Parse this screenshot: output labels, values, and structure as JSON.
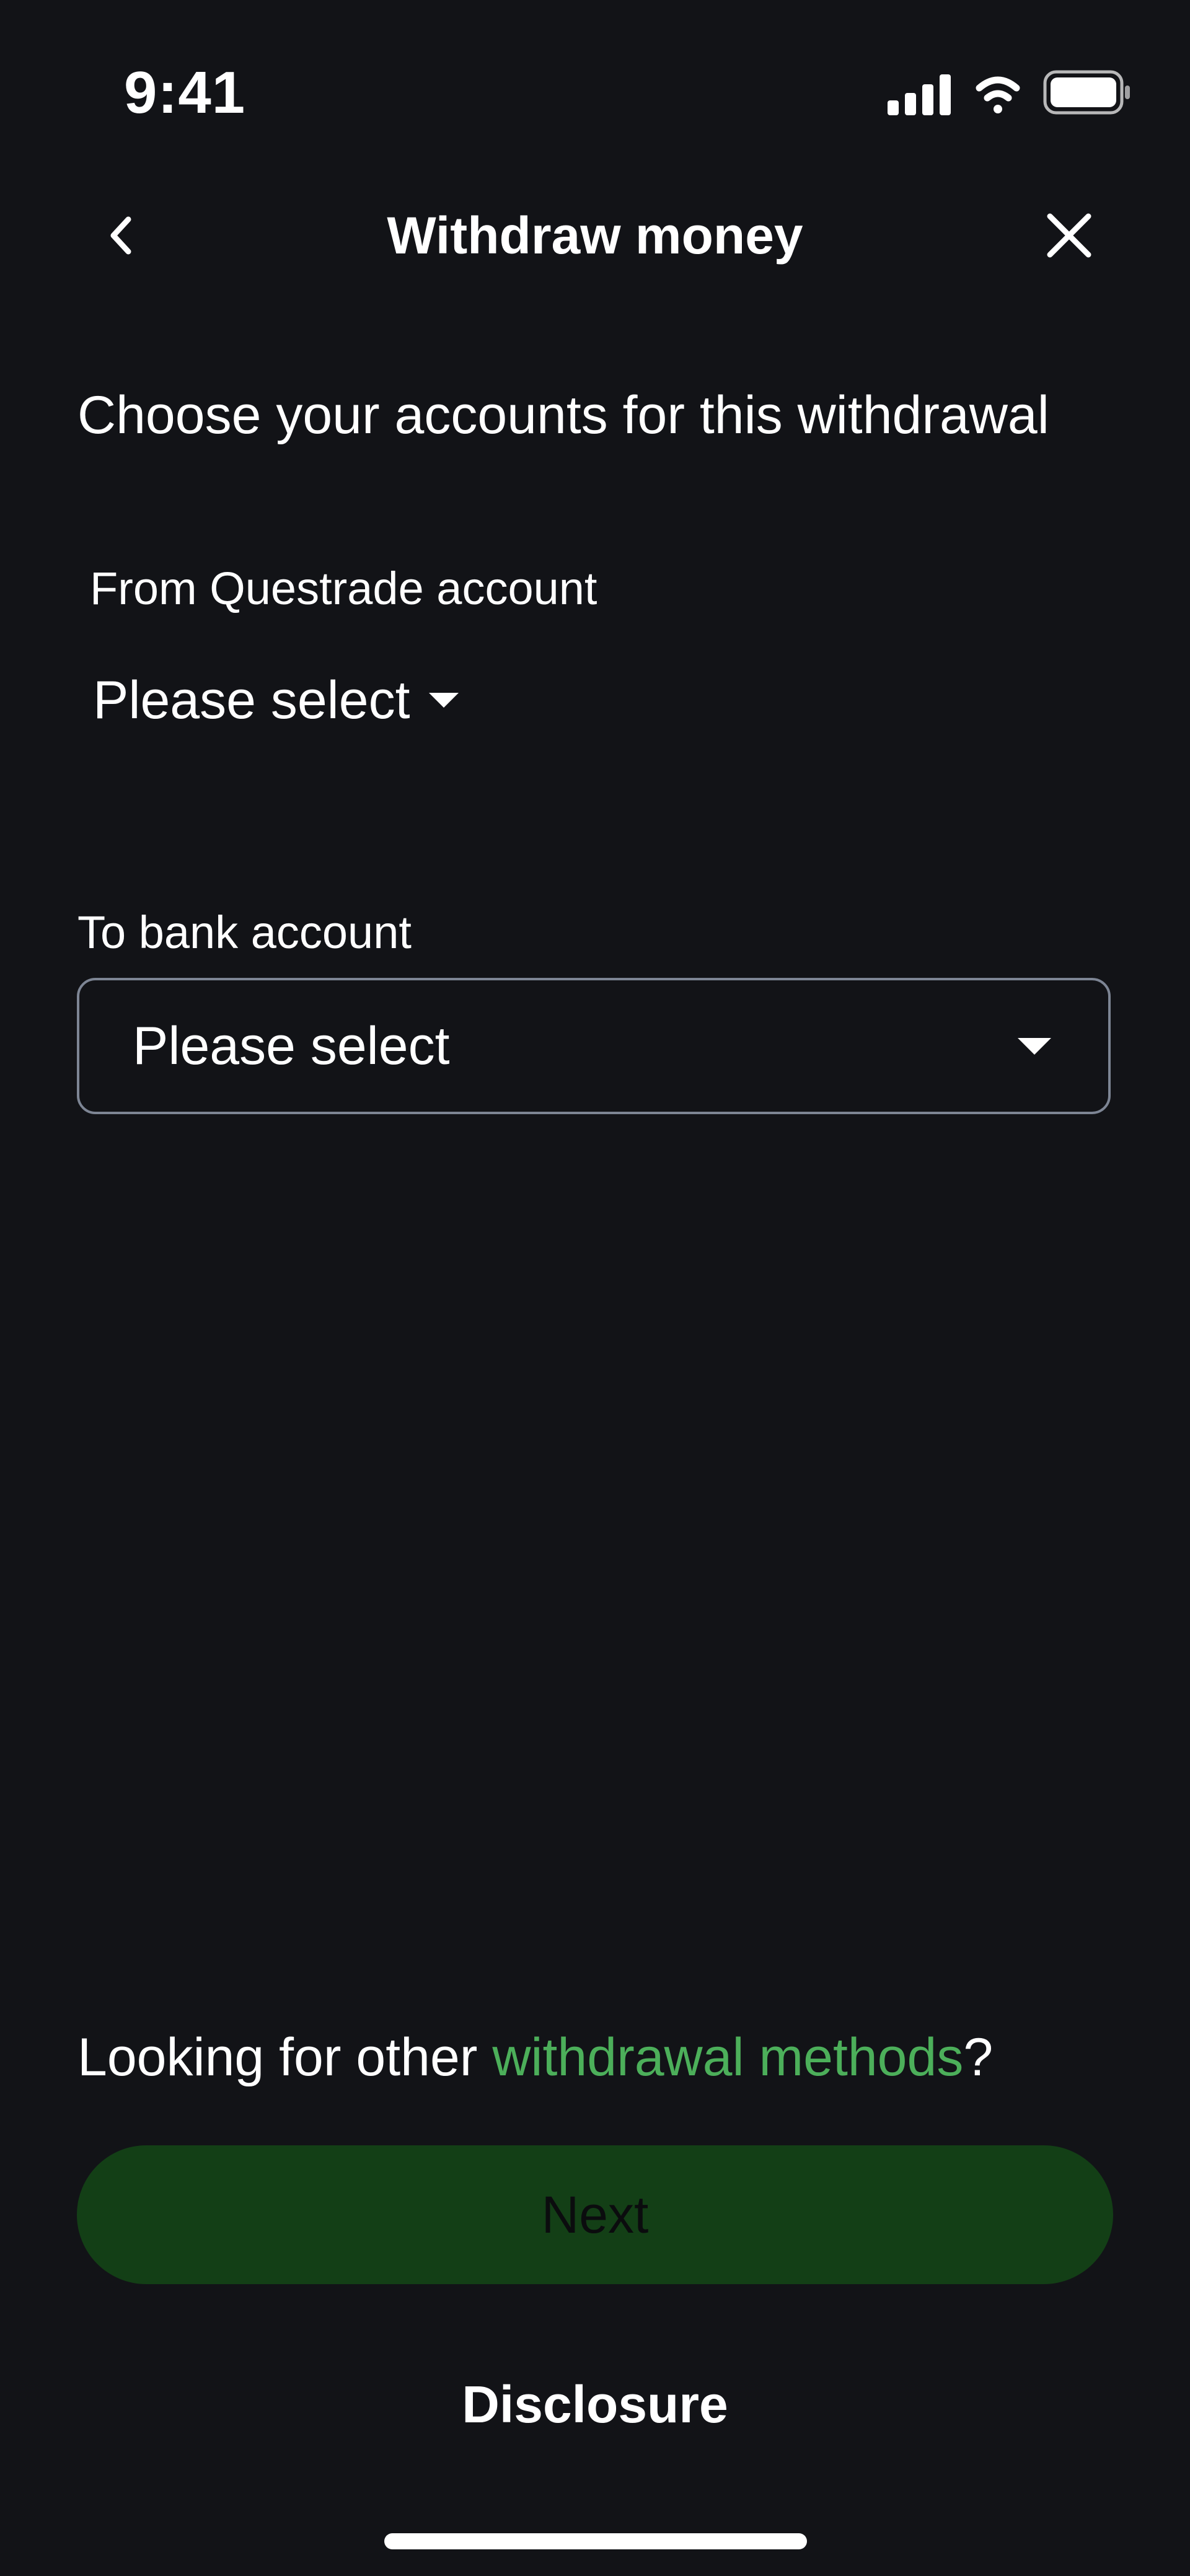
{
  "status_bar": {
    "time": "9:41",
    "icons": [
      "cellular-signal-icon",
      "wifi-icon",
      "battery-icon"
    ]
  },
  "header": {
    "title": "Withdraw money",
    "back_icon": "chevron-left-icon",
    "close_icon": "close-icon"
  },
  "subtitle": "Choose your accounts for this withdrawal",
  "from_account": {
    "label": "From Questrade account",
    "value": "Please select",
    "icon": "caret-down-icon"
  },
  "to_account": {
    "label": "To bank account",
    "value": "Please select",
    "icon": "caret-down-icon"
  },
  "other_methods": {
    "prefix": "Looking for other ",
    "link_text": "withdrawal methods",
    "suffix": "?"
  },
  "next_button": {
    "label": "Next",
    "state": "disabled"
  },
  "disclosure_label": "Disclosure",
  "colors": {
    "background": "#121317",
    "text": "#ffffff",
    "link": "#4caf5a",
    "button_disabled_bg": "#133f16",
    "input_border": "#7d8594"
  }
}
